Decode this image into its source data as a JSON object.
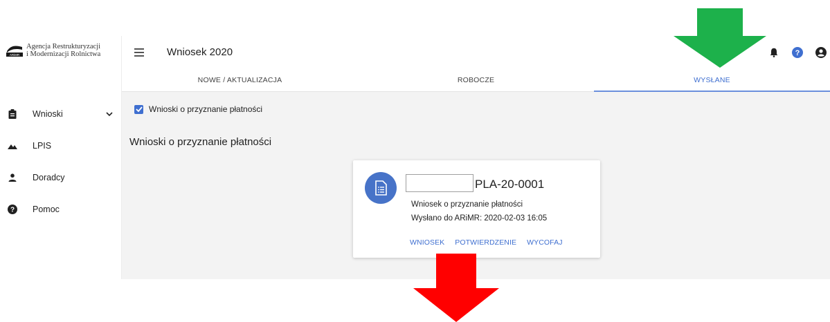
{
  "logo": {
    "line1": "Agencja Restrukturyzacji",
    "line2": "i Modernizacji Rolnictwa",
    "mark_text": "ARiMR"
  },
  "header": {
    "title": "Wniosek 2020",
    "icons": [
      "menu-icon",
      "bell-icon",
      "help-icon",
      "account-icon"
    ]
  },
  "sidebar": {
    "items": [
      {
        "label": "Wnioski",
        "icon": "clipboard-icon",
        "has_chevron": true
      },
      {
        "label": "LPIS",
        "icon": "mountains-icon"
      },
      {
        "label": "Doradcy",
        "icon": "person-icon"
      },
      {
        "label": "Pomoc",
        "icon": "help-icon"
      }
    ]
  },
  "tabs": [
    {
      "label": "NOWE / AKTUALIZACJA",
      "active": false
    },
    {
      "label": "ROBOCZE",
      "active": false
    },
    {
      "label": "WYSŁANE",
      "active": true
    }
  ],
  "main": {
    "filter_label": "Wnioski o przyznanie płatności",
    "filter_checked": true,
    "section_title": "Wnioski o przyznanie płatności",
    "card": {
      "title": "PLA-20-0001",
      "description": "Wniosek o przyznanie płatności",
      "sent": "Wysłano do ARiMR: 2020-02-03 16:05",
      "actions": [
        "WNIOSEK",
        "POTWIERDZENIE",
        "WYCOFAJ"
      ],
      "icon": "document-list-icon"
    }
  },
  "annotations": {
    "arrow_top_color": "#1db14b",
    "arrow_bottom_color": "#ff0000"
  },
  "colors": {
    "accent": "#3f6fd0",
    "avatar": "#4773c8",
    "background": "#f3f3f3"
  }
}
